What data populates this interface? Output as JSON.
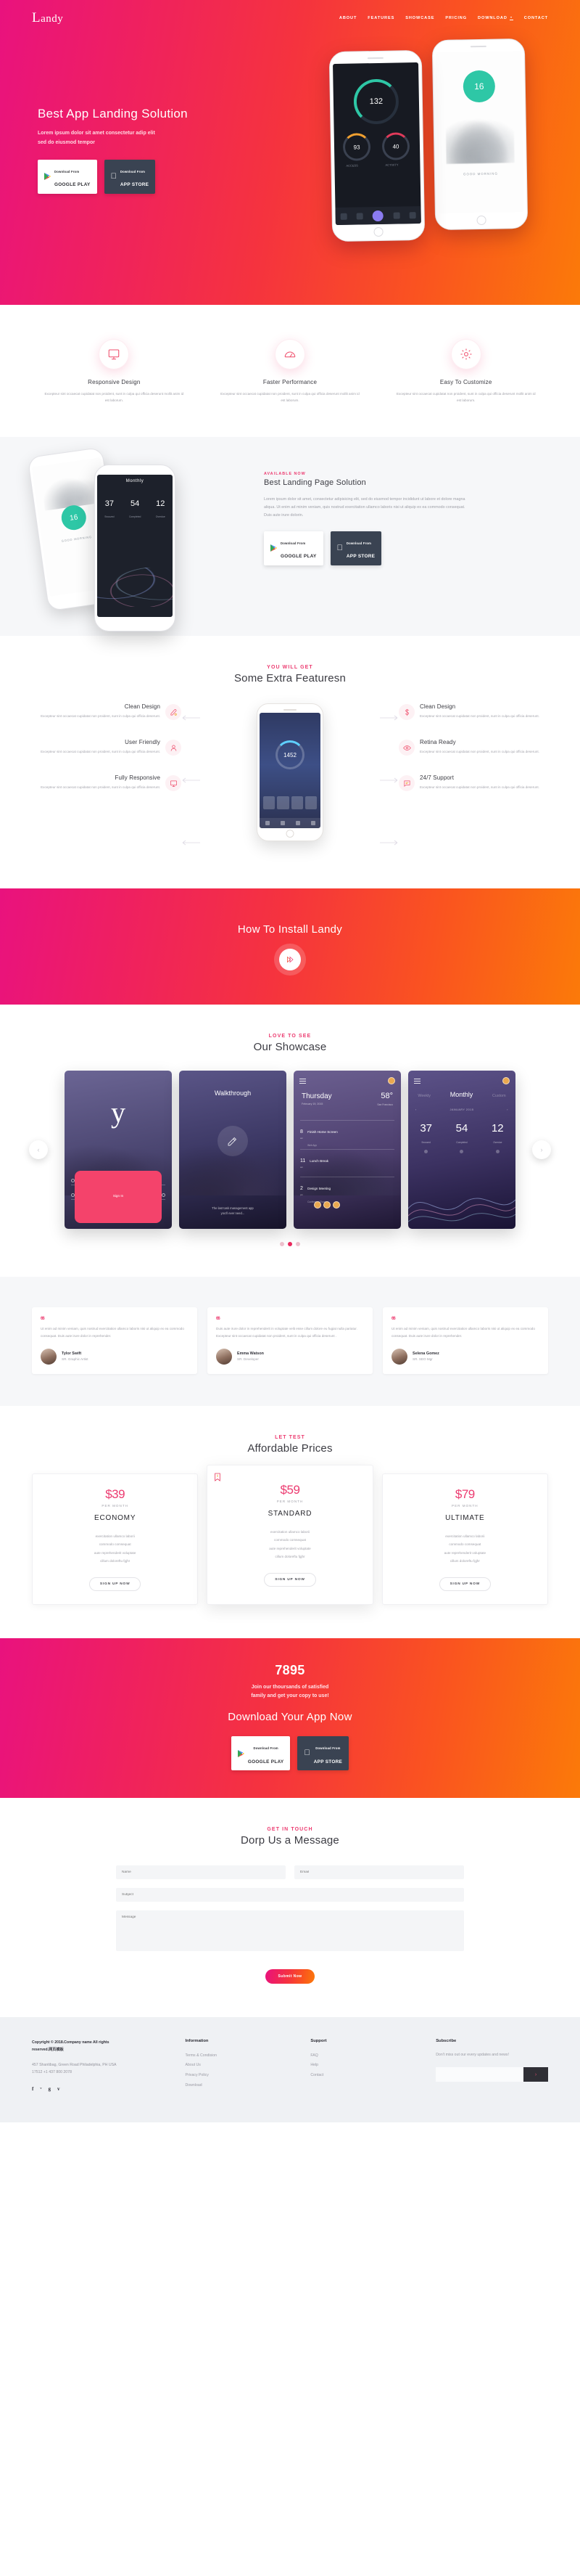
{
  "brand": {
    "logo_cap": "L",
    "logo_rest": "andy",
    "accent": "#ec3b70",
    "grad_from": "#e9127e",
    "grad_to": "#fb7a09"
  },
  "nav": {
    "items": [
      {
        "label": "ABOUT",
        "icon": ""
      },
      {
        "label": "FEATURES",
        "icon": ""
      },
      {
        "label": "SHOWCASE",
        "icon": ""
      },
      {
        "label": "PRICING",
        "icon": ""
      },
      {
        "label": "DOWNLOAD",
        "icon": "download-icon"
      },
      {
        "label": "CONTACT",
        "icon": ""
      }
    ]
  },
  "hero": {
    "title": "Best App Landing Solution",
    "subtitle_line1": "Lorem ipsum dolor sit amet consectetur adip elit",
    "subtitle_line2": "sed do eiusmod tempor",
    "google_top": "Download From",
    "google_bottom": "GOOGLE PLAY",
    "apple_top": "Download From",
    "apple_bottom": "APP STORE",
    "phone_a": {
      "main_value": "132",
      "sub_left": "93",
      "sub_right": "40",
      "cap_left": "ACCESS",
      "cap_right": "ACTIVITY"
    },
    "phone_b": {
      "badge": "16",
      "caption": "GOOD MORNING"
    }
  },
  "features3": [
    {
      "icon": "monitor-icon",
      "title": "Responsive Design",
      "text": "Excepteur sint occaecat cupidatat non proident, sunt in culpa qui officia deserunt mollit anim id est laborum."
    },
    {
      "icon": "speedometer-icon",
      "title": "Faster Performance",
      "text": "Excepteur sint occaecat cupidatat non proident, sunt in culpa qui officia deserunt mollit anim id est laborum."
    },
    {
      "icon": "gear-icon",
      "title": "Easy To Customize",
      "text": "Excepteur sint occaecat cupidatat non proident, sunt in culpa qui officia deserunt mollit anim id est laborum."
    }
  ],
  "solution": {
    "tag": "AVAILABLE NOW",
    "title": "Best Landing Page Solution",
    "text": "Lorem ipsum dolor sit amet, consectetur adipisicing elit, sed do eiusmod tempor incididunt ut labore et dolore magna aliqua. Ut enim ad minim veniam, quis nostrud exercitation ullamco laboris nisi ut aliquip ex ea commodo consequat. Duis aute irure dolorin.",
    "google_top": "Download From",
    "google_bottom": "GOOGLE PLAY",
    "apple_top": "Download From",
    "apple_bottom": "APP STORE",
    "phone_left": {
      "badge": "16",
      "caption": "GOOD MORNING"
    },
    "phone_right": {
      "header": "Monthly",
      "stats": [
        {
          "value": "37",
          "label": "Snoozed"
        },
        {
          "value": "54",
          "label": "Completed"
        },
        {
          "value": "12",
          "label": "Overdue"
        }
      ]
    }
  },
  "extra": {
    "sub": "YOU WILL GET",
    "title": "Some Extra Featuresn",
    "left": [
      {
        "icon": "palette-icon",
        "title": "Clean Design",
        "text": "Excepteur sint occaecat cupidatat non proident, sunt in culpa qui officia deserunt."
      },
      {
        "icon": "user-icon",
        "title": "User Friendly",
        "text": "Excepteur sint occaecat cupidatat non proident, sunt in culpa qui officia deserunt."
      },
      {
        "icon": "monitor-icon",
        "title": "Fully Responsive",
        "text": "Excepteur sint occaecat cupidatat non proident, sunt in culpa qui officia deserunt."
      }
    ],
    "right": [
      {
        "icon": "dollar-icon",
        "title": "Clean Design",
        "text": "Excepteur sint occaecat cupidatat non proident, sunt in culpa qui officia deserunt."
      },
      {
        "icon": "eye-icon",
        "title": "Retina Ready",
        "text": "Excepteur sint occaecat cupidatat non proident, sunt in culpa qui officia deserunt."
      },
      {
        "icon": "chat-icon",
        "title": "24/7 Support",
        "text": "Excepteur sint occaecat cupidatat non proident, sunt in culpa qui officia deserunt."
      }
    ],
    "phone_value": "1452"
  },
  "install": {
    "title": "How To Install Landy",
    "play_icon": "play-icon"
  },
  "showcase": {
    "sub": "LOVE TO SEE",
    "title": "Our Showcase",
    "slides": [
      {
        "kind": "login",
        "logo": "y",
        "username_placeholder": "Username",
        "password_placeholder": "Password",
        "button": "Sign In"
      },
      {
        "kind": "walkthrough",
        "title": "Walkthrough",
        "footer_line1": "The last task management app",
        "footer_line2": "you'll ever need..."
      },
      {
        "kind": "agenda",
        "day": "Thursday",
        "date": "February 19, 2015",
        "temp": "58°",
        "city": "San Francisco",
        "events": [
          {
            "num": "8",
            "ampm": "am",
            "title": "Finish Home Screen",
            "sub": "Web App"
          },
          {
            "num": "11",
            "ampm": "am",
            "title": "Lunch Break",
            "sub": ""
          },
          {
            "num": "2",
            "ampm": "pm",
            "title": "Design Meeting",
            "sub": "Conference Room"
          }
        ]
      },
      {
        "kind": "stats",
        "tab_left": "Weekly",
        "tab_active": "Monthly",
        "tab_right": "Custom",
        "month": "JANUARY 2015",
        "stats": [
          {
            "value": "37",
            "label": "Snoozed"
          },
          {
            "value": "54",
            "label": "Completed"
          },
          {
            "value": "12",
            "label": "Overdue"
          }
        ]
      }
    ],
    "prev_icon": "chevron-left-icon",
    "next_icon": "chevron-right-icon",
    "dots": 3,
    "active_dot": 1
  },
  "testimonials": [
    {
      "quote_mark": "66",
      "text": "Ut enim ad minim veniam, quis nostrud exercitation ullamco laboris nisi ut aliquip ex ea commodo consequat. Duis aute irure dolor in reprehender.",
      "name": "Tylor Swift",
      "role": "SR. Graphic Artist"
    },
    {
      "quote_mark": "66",
      "text": "Duis aute irure dolor in reprehenderit in voluptate velit esse cillum dolore eu fugiat nulla pariatur. Excepteur sint occaecat cupidatat non proident, sunt in culpa qui officia deserunt .",
      "name": "Emma Watson",
      "role": "SR. Developer"
    },
    {
      "quote_mark": "66",
      "text": "Ut enim ad minim veniam, quis nostrud exercitation ullamco laboris nisi ut aliquip ex ea commodo consequat. Duis aute irure dolor in reprehender.",
      "name": "Selena Gomez",
      "role": "SR. SEO Mgr"
    }
  ],
  "pricing": {
    "sub": "LET TEST",
    "title": "Affordable Prices",
    "plans": [
      {
        "price": "$39",
        "per": "PER MONTH",
        "name": "ECONOMY",
        "featured": false,
        "ribbon": "",
        "features": [
          "exercitation ullamco laborii",
          "commodo comsequat",
          "aute reprehenderit voluptate",
          "cillum doloreftu fgjhr"
        ],
        "button": "SIGN UP NOW"
      },
      {
        "price": "$59",
        "per": "PER MONTH",
        "name": "STANDARD",
        "featured": true,
        "ribbon": "bookmark-icon",
        "features": [
          "exercitation ullamco laborii",
          "commodo comsequat",
          "aute reprehenderit voluptate",
          "cillum doloreftu fgjhr"
        ],
        "button": "SIGN UP NOW"
      },
      {
        "price": "$79",
        "per": "PER MONTH",
        "name": "ULTIMATE",
        "featured": false,
        "ribbon": "",
        "features": [
          "exercitation ullamco laborii",
          "commodo comsequat",
          "aute reprehenderit voluptate",
          "cillum doloreftu fgjhr"
        ],
        "button": "SIGN UP NOW"
      }
    ]
  },
  "cta": {
    "count": "7895",
    "sub_line1": "Join our thoursands of satisfied",
    "sub_line2": "family and get your copy to use!",
    "title": "Download Your App Now",
    "google_top": "Download From",
    "google_bottom": "GOOGLE PLAY",
    "apple_top": "Download From",
    "apple_bottom": "APP STORE"
  },
  "contact": {
    "sub": "GET IN TOUCH",
    "title": "Dorp Us a Message",
    "name_placeholder": "Name",
    "email_placeholder": "Email",
    "subject_placeholder": "Subject",
    "message_placeholder": "Message",
    "submit": "Submit Now"
  },
  "footer": {
    "copyright": "Copyright © 2018.Company name All rights reserved.网页模板",
    "address": "457 Shantibag, Green Road Philadelphia, PH USA 17512 +1 437 800 2078",
    "social": [
      "f",
      "ᵛ",
      "g",
      "v"
    ],
    "information_heading": "Information",
    "information_links": [
      "Terms & Condision",
      "About Us",
      "Privacy Policy",
      "Download"
    ],
    "support_heading": "Support",
    "support_links": [
      "FAQ",
      "Help",
      "Contact"
    ],
    "subscribe_heading": "Subscribe",
    "subscribe_text": "Don't miss out our every updates and news!",
    "subscribe_placeholder": "",
    "subscribe_icon": "chevron-right-icon"
  }
}
